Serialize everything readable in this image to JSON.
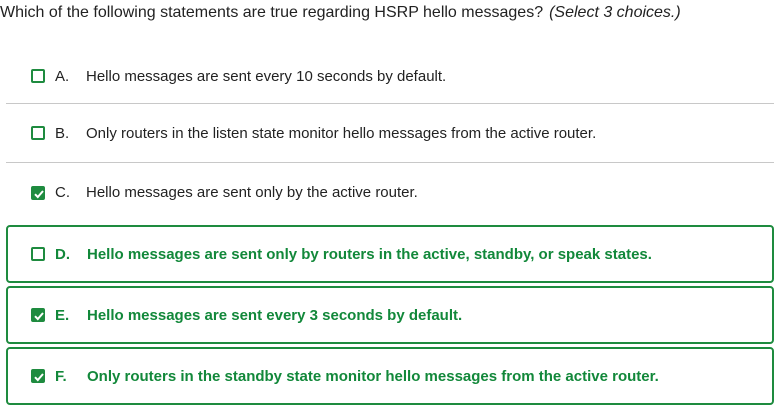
{
  "question": {
    "text": "Which of the following statements are true regarding HSRP hello messages?",
    "hint": "(Select 3 choices.)"
  },
  "options": [
    {
      "letter": "A.",
      "text": "Hello messages are sent every 10 seconds by default.",
      "checked": false,
      "highlighted": false
    },
    {
      "letter": "B.",
      "text": "Only routers in the listen state monitor hello messages from the active router.",
      "checked": false,
      "highlighted": false
    },
    {
      "letter": "C.",
      "text": "Hello messages are sent only by the active router.",
      "checked": true,
      "highlighted": false
    },
    {
      "letter": "D.",
      "text": "Hello messages are sent only by routers in the active, standby, or speak states.",
      "checked": false,
      "highlighted": true
    },
    {
      "letter": "E.",
      "text": "Hello messages are sent every 3 seconds by default.",
      "checked": true,
      "highlighted": true
    },
    {
      "letter": "F.",
      "text": "Only routers in the standby state monitor hello messages from the active router.",
      "checked": true,
      "highlighted": true
    }
  ],
  "colors": {
    "accent_green": "#1e8b3f",
    "correct_text": "#12883a",
    "divider": "#c8c8c8"
  }
}
